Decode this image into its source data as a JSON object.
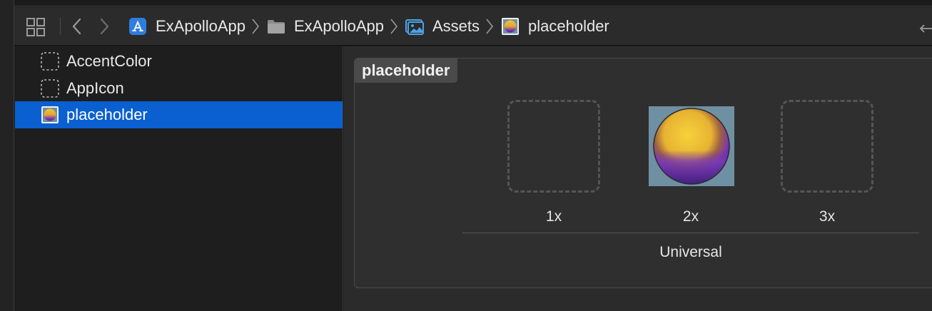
{
  "jumpbar": {
    "crumbs": [
      {
        "label": "ExApolloApp",
        "icon": "app-project-icon"
      },
      {
        "label": "ExApolloApp",
        "icon": "folder-icon"
      },
      {
        "label": "Assets",
        "icon": "asset-catalog-icon"
      },
      {
        "label": "placeholder",
        "icon": "image-set-icon"
      }
    ]
  },
  "sidebar": {
    "items": [
      {
        "label": "AccentColor",
        "icon": "color-set-icon",
        "selected": false
      },
      {
        "label": "AppIcon",
        "icon": "app-icon-set-icon",
        "selected": false
      },
      {
        "label": "placeholder",
        "icon": "image-set-icon",
        "selected": true
      }
    ]
  },
  "editor": {
    "set_name": "placeholder",
    "slots": [
      {
        "label": "1x",
        "filled": false
      },
      {
        "label": "2x",
        "filled": true
      },
      {
        "label": "3x",
        "filled": false
      }
    ],
    "device_group": "Universal"
  },
  "colors": {
    "selection": "#0a5fd1",
    "background": "#1e1e1e",
    "toolbar": "#2b2b2b"
  }
}
